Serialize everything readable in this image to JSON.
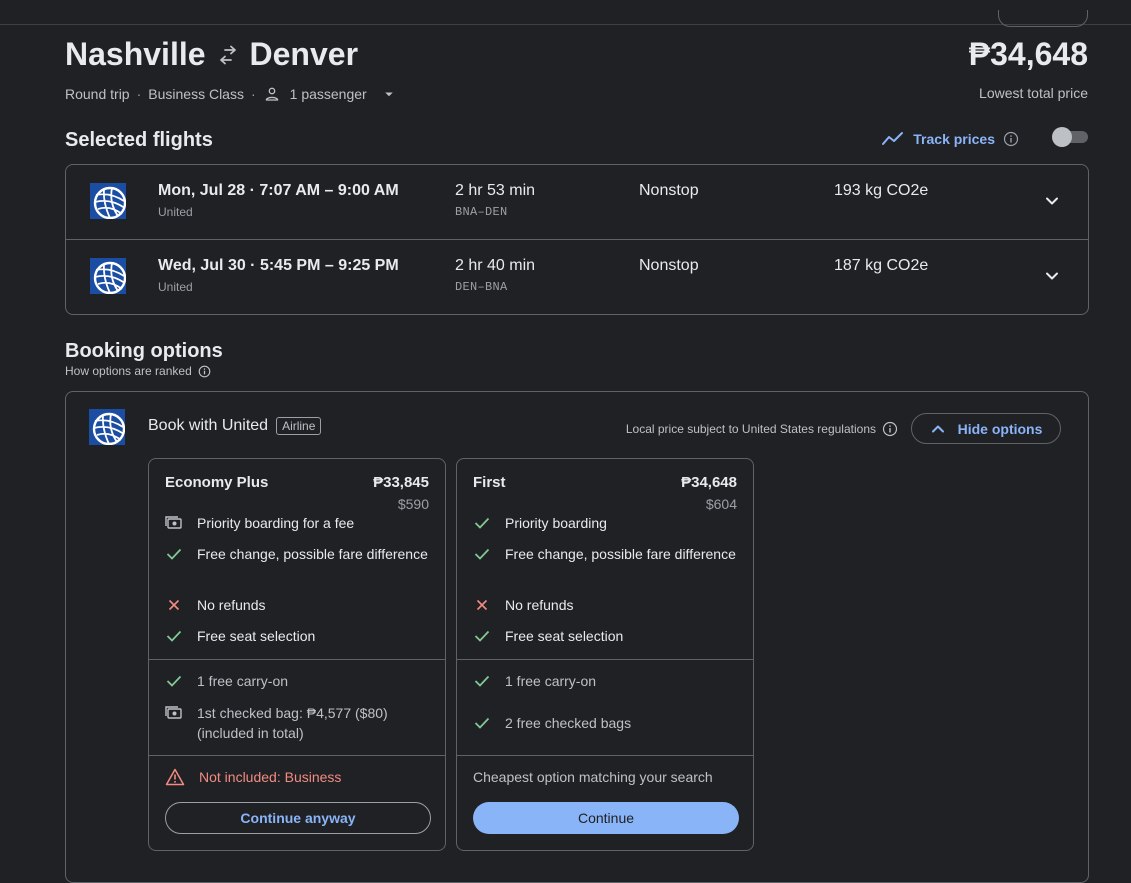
{
  "header": {
    "origin": "Nashville",
    "destination": "Denver",
    "total_price": "₱34,648",
    "price_note": "Lowest total price",
    "trip_type": "Round trip",
    "cabin_class": "Business Class",
    "passengers": "1 passenger"
  },
  "selected_flights": {
    "heading": "Selected flights",
    "track_prices_label": "Track prices",
    "track_prices_on": false,
    "flights": [
      {
        "time": "Mon, Jul 28  ·  7:07 AM – 9:00 AM",
        "airline": "United",
        "duration": "2 hr 53 min",
        "route": "BNA–DEN",
        "stops": "Nonstop",
        "emissions": "193 kg CO2e"
      },
      {
        "time": "Wed, Jul 30  ·  5:45 PM – 9:25 PM",
        "airline": "United",
        "duration": "2 hr 40 min",
        "route": "DEN–BNA",
        "stops": "Nonstop",
        "emissions": "187 kg CO2e"
      }
    ]
  },
  "booking": {
    "heading": "Booking options",
    "ranked_note": "How options are ranked",
    "provider": "Book with United",
    "provider_badge": "Airline",
    "regulation_note": "Local price subject to United States regulations",
    "hide_options_label": "Hide options",
    "cards": [
      {
        "name": "Economy Plus",
        "price": "₱33,845",
        "usd": "$590",
        "features": [
          {
            "icon": "money-icon",
            "text": "Priority boarding for a fee"
          },
          {
            "icon": "check-icon",
            "text": "Free change, possible fare difference"
          },
          {
            "icon": "cross-icon",
            "text": "No refunds"
          },
          {
            "icon": "check-icon",
            "text": "Free seat selection"
          }
        ],
        "bags": [
          {
            "icon": "check-icon",
            "text": "1 free carry-on"
          },
          {
            "icon": "money-icon",
            "text": "1st checked bag: ₱4,577 ($80) (included in total)"
          }
        ],
        "notice": "Not included: Business",
        "button": "Continue anyway"
      },
      {
        "name": "First",
        "price": "₱34,648",
        "usd": "$604",
        "features": [
          {
            "icon": "check-icon",
            "text": "Priority boarding"
          },
          {
            "icon": "check-icon",
            "text": "Free change, possible fare difference"
          },
          {
            "icon": "cross-icon",
            "text": "No refunds"
          },
          {
            "icon": "check-icon",
            "text": "Free seat selection"
          }
        ],
        "bags": [
          {
            "icon": "check-icon",
            "text": "1 free carry-on"
          },
          {
            "icon": "check-icon",
            "text": "2 free checked bags"
          }
        ],
        "notice": "Cheapest option matching your search",
        "button": "Continue"
      }
    ]
  },
  "colors": {
    "background": "#202124",
    "accent": "#8ab4f8",
    "check": "#81c995",
    "cross": "#f28b82",
    "border": "#5f6368"
  }
}
